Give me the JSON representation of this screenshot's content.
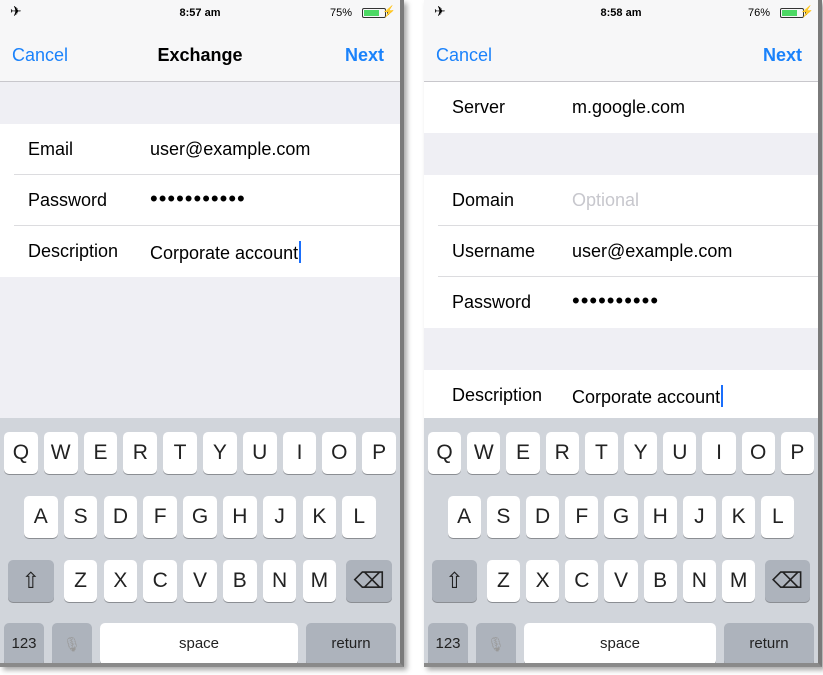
{
  "screens": [
    {
      "status": {
        "time": "8:57 am",
        "battery": "75%",
        "battery_level": 0.75
      },
      "nav": {
        "cancel": "Cancel",
        "title": "Exchange",
        "next": "Next"
      },
      "fields": [
        {
          "label": "Email",
          "value": "user@example.com"
        },
        {
          "label": "Password",
          "value": "•••••••••••"
        },
        {
          "label": "Description",
          "value": "Corporate account"
        }
      ]
    },
    {
      "status": {
        "time": "8:58 am",
        "battery": "76%",
        "battery_level": 0.76
      },
      "nav": {
        "cancel": "Cancel",
        "title": "",
        "next": "Next"
      },
      "server": {
        "label": "Server",
        "value": "m.google.com"
      },
      "fields": [
        {
          "label": "Domain",
          "placeholder": "Optional"
        },
        {
          "label": "Username",
          "value": "user@example.com"
        },
        {
          "label": "Password",
          "value": "••••••••••"
        }
      ],
      "description": {
        "label": "Description",
        "value": "Corporate account"
      }
    }
  ],
  "keyboard": {
    "row1": [
      "Q",
      "W",
      "E",
      "R",
      "T",
      "Y",
      "U",
      "I",
      "O",
      "P"
    ],
    "row2": [
      "A",
      "S",
      "D",
      "F",
      "G",
      "H",
      "J",
      "K",
      "L"
    ],
    "row3": [
      "Z",
      "X",
      "C",
      "V",
      "B",
      "N",
      "M"
    ],
    "numbers": "123",
    "space": "space",
    "return": "return",
    "shift_icon": "shift-icon",
    "delete_icon": "delete-icon",
    "mic_icon": "microphone-icon"
  },
  "colors": {
    "accent": "#1a82fb",
    "battery": "#4cd964",
    "keyboard_bg": "#d1d5db"
  }
}
